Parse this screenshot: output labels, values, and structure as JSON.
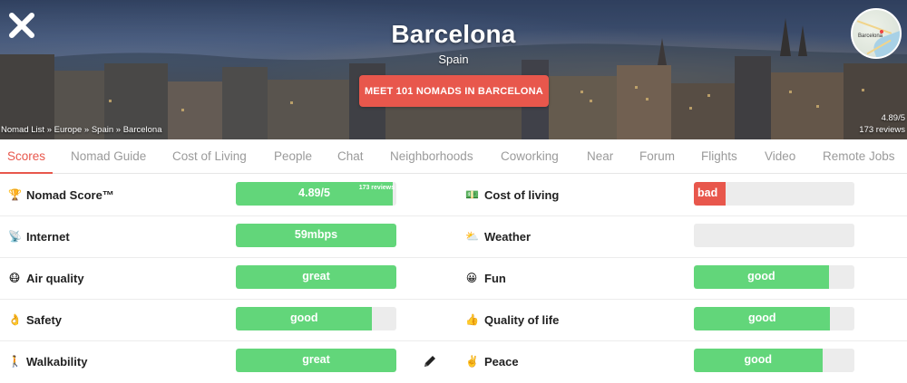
{
  "hero": {
    "city": "Barcelona",
    "country": "Spain",
    "meet_button": "MEET 101 NOMADS IN BARCELONA",
    "map_label": "Barcelona",
    "breadcrumb": [
      "Nomad List",
      "Europe",
      "Spain",
      "Barcelona"
    ],
    "breadcrumb_sep": " » ",
    "rating": "4.89/5",
    "reviews": "173 reviews"
  },
  "tabs": [
    {
      "label": "Scores",
      "active": true
    },
    {
      "label": "Nomad Guide"
    },
    {
      "label": "Cost of Living"
    },
    {
      "label": "People"
    },
    {
      "label": "Chat"
    },
    {
      "label": "Neighborhoods"
    },
    {
      "label": "Coworking"
    },
    {
      "label": "Near"
    },
    {
      "label": "Forum"
    },
    {
      "label": "Flights"
    },
    {
      "label": "Video"
    },
    {
      "label": "Remote Jobs"
    }
  ],
  "scores_left": [
    {
      "emoji": "🏆",
      "label": "Nomad Score™",
      "value": "4.89/5",
      "level": 0.978,
      "sub": "173 reviews"
    },
    {
      "emoji": "📡",
      "label": "Internet",
      "value": "59mbps",
      "level": 1.0
    },
    {
      "emoji": "😷",
      "label": "Air quality",
      "value": "great",
      "level": 1.0
    },
    {
      "emoji": "👌",
      "label": "Safety",
      "value": "good",
      "level": 0.85
    },
    {
      "emoji": "🚶",
      "label": "Walkability",
      "value": "great",
      "level": 1.0
    }
  ],
  "scores_right": [
    {
      "emoji": "💵",
      "label": "Cost of living",
      "value": "bad",
      "level": 0.2,
      "tone": "red"
    },
    {
      "emoji": "⛅",
      "label": "Weather",
      "value": "",
      "level": 0
    },
    {
      "emoji": "😀",
      "label": "Fun",
      "value": "good",
      "level": 0.84
    },
    {
      "emoji": "👍",
      "label": "Quality of life",
      "value": "good",
      "level": 0.85
    },
    {
      "emoji": "✌️",
      "label": "Peace",
      "value": "good",
      "level": 0.8
    }
  ],
  "colors": {
    "accent": "#e8574c",
    "good": "#62d67a",
    "track": "#ececec"
  }
}
